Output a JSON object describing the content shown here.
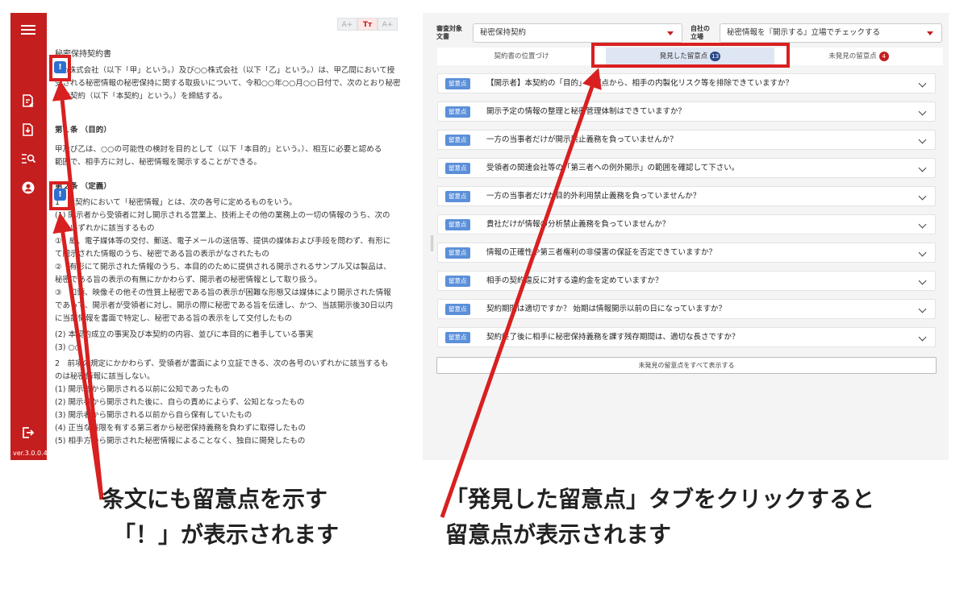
{
  "app": {
    "version": "ver.3.0.0.4"
  },
  "sidebar": {
    "icons": [
      "menu-icon",
      "edit-document-icon",
      "download-document-icon",
      "search-list-icon",
      "account-icon",
      "logout-icon"
    ]
  },
  "font_controls": {
    "decrease": "A+",
    "current": "Tт",
    "increase": "A+"
  },
  "document": {
    "title": "秘密保持契約書",
    "lines": [
      "○○株式会社（以下「甲」という。）及び○○株式会社（以下「乙」という。）は、甲乙間において授",
      "受される秘密情報の秘密保持に関する取扱いについて、令和○○年○○月○○日付で、次のとおり秘密",
      "保持契約（以下「本契約」という。）を締結する。",
      "",
      "第１条 （目的）",
      "甲及び乙は、○○の可能性の検討を目的として（以下「本目的」という。）、相互に必要と認める",
      "範囲で、相手方に対し、秘密情報を開示することができる。",
      "",
      "第２条 （定義）",
      "1　本契約において「秘密情報」とは、次の各号に定めるものをいう。",
      "(1) 開示者から受領者に対し開示される営業上、技術上その他の業務上の一切の情報のうち、次の",
      "　　いずれかに該当するもの",
      "①　紙、電子媒体等の交付、郵送、電子メールの送信等、提供の媒体および手段を問わず、有形に",
      "て開示された情報のうち、秘密である旨の表示がなされたもの",
      "②　有形にて開示された情報のうち、本目的のために提供される開示されるサンプル又は製品は、",
      "秘密である旨の表示の有無にかかわらず、開示者の秘密情報として取り扱う。",
      "③　口頭、映像その他その性質上秘密である旨の表示が困難な形態又は媒体により開示された情報",
      "であって、開示者が受領者に対し、開示の際に秘密である旨を伝達し、かつ、当該開示後30日以内",
      "に当該情報を書面で特定し、秘密である旨の表示をして交付したもの",
      "(2) 本契約成立の事実及び本契約の内容、並びに本目的に着手している事実",
      "(3) ○○",
      "2　前項の規定にかかわらず、受領者が書面により立証できる、次の各号のいずれかに該当するも",
      "のは秘密情報に該当しない。",
      "(1) 開示者から開示される以前に公知であったもの",
      "(2) 開示者から開示された後に、自らの責めによらず、公知となったもの",
      "(3) 開示者から開示される以前から自ら保有していたもの",
      "(4) 正当な権限を有する第三者から秘密保持義務を負わずに取得したもの",
      "(5) 相手方から開示された秘密情報によることなく、独自に開発したもの"
    ],
    "warning_symbol": "!"
  },
  "review": {
    "doc_type_label": "審査対象文書",
    "doc_type_value": "秘密保持契約",
    "stance_label": "自社の立場",
    "stance_value": "秘密情報を『開示する』立場でチェックする",
    "tabs": [
      {
        "label": "契約書の位置づけ",
        "count": ""
      },
      {
        "label": "発見した留意点",
        "count": "13"
      },
      {
        "label": "未発見の留意点",
        "count": "4"
      }
    ],
    "badge_label": "留意点",
    "items": [
      "【開示者】本契約の「目的」の観点から、相手の内製化リスク等を排除できていますか？",
      "開示予定の情報の整理と秘密管理体制はできていますか？",
      "一方の当事者だけが開示禁止義務を負っていませんか？",
      "受領者の関連会社等の「第三者への例外開示」の範囲を確認して下さい。",
      "一方の当事者だけが目的外利用禁止義務を負っていませんか？",
      "貴社だけが情報の分析禁止義務を負っていませんか？",
      "情報の正確性や第三者権利の非侵害の保証を否定できていますか？",
      "相手の契約違反に対する違約金を定めていますか？",
      "契約期間は適切ですか？ 始期は情報開示以前の日になっていますか？",
      "契約終了後に相手に秘密保持義務を課す残存期間は、適切な長さですか？"
    ],
    "show_all_label": "未発見の留意点をすべて表示する"
  },
  "captions": {
    "left_line1": "条文にも留意点を示す",
    "left_line2": "「！」が表示されます",
    "right_line1": "「発見した留意点」タブをクリックすると",
    "right_line2": "留意点が表示されます"
  },
  "colors": {
    "brand_red": "#c51e1e",
    "highlight_red": "#d82020",
    "badge_blue": "#5b8fd9",
    "tab_active": "#dfe6f3"
  }
}
